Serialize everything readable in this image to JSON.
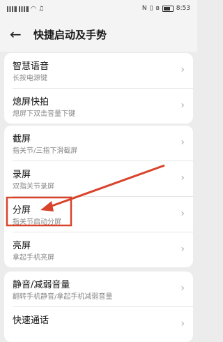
{
  "status": {
    "time": "8:53",
    "battery": ""
  },
  "header": {
    "title": "快捷启动及手势"
  },
  "group1": [
    {
      "title": "智慧语音",
      "subtitle": "长按电源键"
    },
    {
      "title": "熄屏快拍",
      "subtitle": "熄屏下双击音量下键"
    }
  ],
  "group2": [
    {
      "title": "截屏",
      "subtitle": "指关节/三指下滑截屏"
    },
    {
      "title": "录屏",
      "subtitle": "双指关节录屏"
    },
    {
      "title": "分屏",
      "subtitle": "指关节启动分屏"
    },
    {
      "title": "亮屏",
      "subtitle": "拿起手机亮屏"
    }
  ],
  "group3": [
    {
      "title": "静音/减弱音量",
      "subtitle": "翻转手机静音/拿起手机减弱音量"
    },
    {
      "title": "快速通话",
      "subtitle": ""
    }
  ],
  "colors": {
    "annotation": "#d9432b"
  }
}
